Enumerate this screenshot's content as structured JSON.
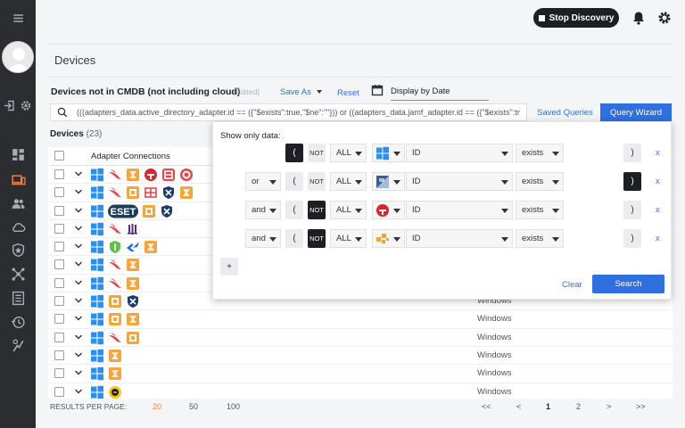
{
  "sidebar": {
    "icons": [
      "menu-icon",
      "avatar",
      "logout-icon",
      "gear-icon",
      "dashboard-icon",
      "devices-icon",
      "users-icon",
      "cloud-icon",
      "shield-icon",
      "adapters-icon",
      "report-icon",
      "history-icon",
      "enforcement-icon"
    ]
  },
  "topbar": {
    "stop_label": "Stop Discovery",
    "icons": [
      "bell-icon",
      "gear-icon"
    ]
  },
  "page": {
    "title": "Devices",
    "query_name": "Devices not in CMDB (not including cloud)",
    "edited": "[Edited]",
    "save_as": "Save As",
    "reset": "Reset",
    "display_by_date": "Display by Date",
    "query": "(((adapters_data.active_directory_adapter.id == ({\"$exists\":true,\"$ne\":\"\"})) or ((adapters_data.jamf_adapter.id == ({\"$exists\":tr",
    "saved_queries": "Saved Queries",
    "query_wizard": "Query Wizard",
    "devices_label": "Devices",
    "devices_count": "(23)"
  },
  "table": {
    "column_adapter_connections": "Adapter Connections",
    "rows": [
      {
        "adapters": [
          "windows",
          "crowdstrike",
          "fortinet",
          "red-circle",
          "red-box",
          "red-target"
        ],
        "os": ""
      },
      {
        "adapters": [
          "windows",
          "crowdstrike",
          "orange-cube",
          "grid-red",
          "shield-blue",
          "fortinet"
        ],
        "os": ""
      },
      {
        "adapters": [
          "windows",
          "eset",
          "orange-cube",
          "shield-blue"
        ],
        "os": ""
      },
      {
        "adapters": [
          "windows",
          "crowdstrike",
          "purple-bars"
        ],
        "os": ""
      },
      {
        "adapters": [
          "windows",
          "green-shield",
          "blue-k",
          "fortinet"
        ],
        "os": ""
      },
      {
        "adapters": [
          "windows",
          "crowdstrike",
          "fortinet"
        ],
        "os": ""
      },
      {
        "adapters": [
          "windows",
          "crowdstrike",
          "fortinet"
        ],
        "os": ""
      },
      {
        "adapters": [
          "windows",
          "orange-cube",
          "shield-blue"
        ],
        "os": "Windows"
      },
      {
        "adapters": [
          "windows",
          "orange-cube",
          "fortinet"
        ],
        "os": "Windows"
      },
      {
        "adapters": [
          "windows",
          "crowdstrike",
          "orange-cube"
        ],
        "os": "Windows"
      },
      {
        "adapters": [
          "windows",
          "fortinet"
        ],
        "os": "Windows"
      },
      {
        "adapters": [
          "windows",
          "fortinet"
        ],
        "os": "Windows"
      },
      {
        "adapters": [
          "windows",
          "yellow-circle"
        ],
        "os": "Windows"
      }
    ]
  },
  "pager": {
    "label": "RESULTS PER PAGE:",
    "options": [
      "20",
      "50",
      "100"
    ],
    "selected": "20",
    "nav": [
      "<<",
      "<",
      "1",
      "2",
      ">",
      ">>"
    ],
    "current_page": "1"
  },
  "wizard": {
    "title": "Show only data:",
    "rows": [
      {
        "logic": "",
        "open_paren": "(",
        "open_dark": true,
        "not": "NOT",
        "not_dark": false,
        "all": "ALL",
        "adapter": "windows",
        "field": "ID",
        "op": "exists",
        "close_paren": ")",
        "close_dark": false,
        "remove": "x"
      },
      {
        "logic": "or",
        "open_paren": "(",
        "open_dark": false,
        "not": "NOT",
        "not_dark": false,
        "all": "ALL",
        "adapter": "jamf",
        "field": "ID",
        "op": "exists",
        "close_paren": ")",
        "close_dark": true,
        "remove": "x"
      },
      {
        "logic": "and",
        "open_paren": "(",
        "open_dark": false,
        "not": "NOT",
        "not_dark": true,
        "all": "ALL",
        "adapter": "red-circle",
        "field": "ID",
        "op": "exists",
        "close_paren": ")",
        "close_dark": false,
        "remove": "x"
      },
      {
        "logic": "and",
        "open_paren": "(",
        "open_dark": false,
        "not": "NOT",
        "not_dark": true,
        "all": "ALL",
        "adapter": "orange-puzzle",
        "field": "ID",
        "op": "exists",
        "close_paren": ")",
        "close_dark": false,
        "remove": "x"
      }
    ],
    "add": "+",
    "clear": "Clear",
    "search": "Search"
  },
  "colors": {
    "accent": "#2f6fe0",
    "sidebar_bg": "#2b2d31",
    "dark_button": "#1d1f24",
    "pager_selected": "#f0813c"
  }
}
